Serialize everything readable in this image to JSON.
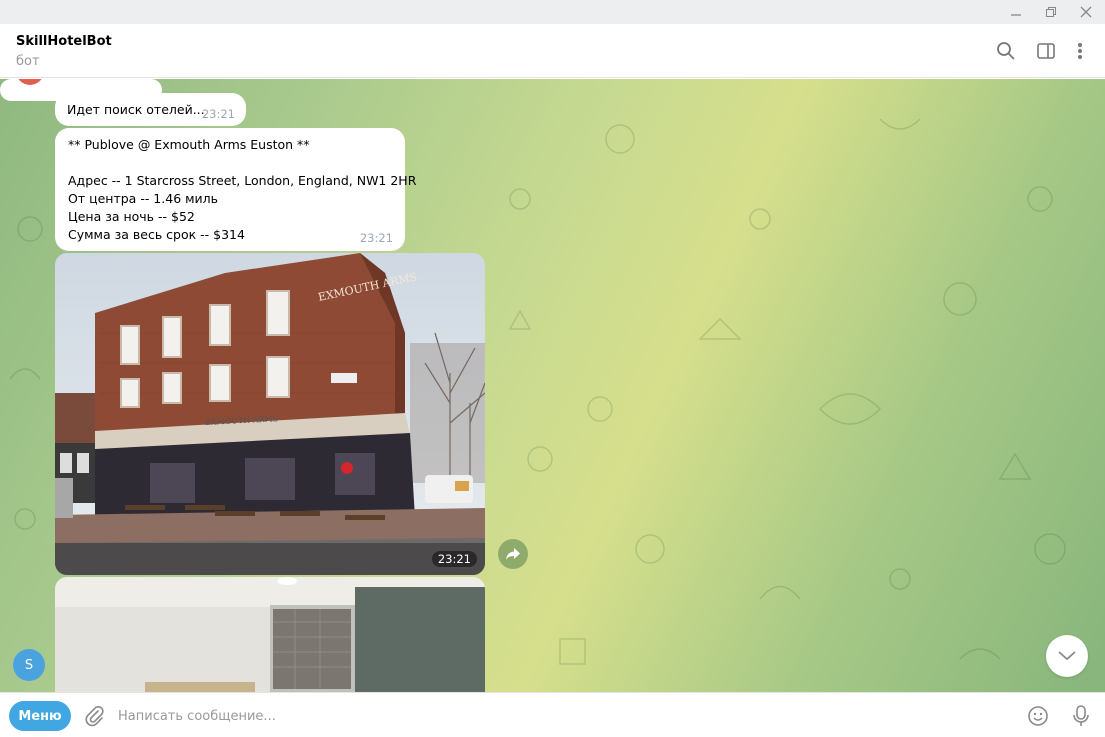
{
  "window": {
    "minimize_icon": "minimize-icon",
    "restore_icon": "restore-icon",
    "close_icon": "close-icon"
  },
  "header": {
    "title": "SkillHotelBot",
    "subtitle": "бот",
    "icons": [
      "search-icon",
      "side-panel-icon",
      "more-vertical-icon"
    ]
  },
  "messages": {
    "searching": {
      "text": "Идет поиск отелей...",
      "time": "23:21"
    },
    "hotel": {
      "name_line": "** Publove @ Exmouth Arms Euston **",
      "address": "Адрес -- 1 Starcross Street, London, England, NW1 2HR",
      "distance": "От центра -- 1.46 миль",
      "price_night": "Цена за ночь -- $52",
      "price_total": "Сумма за весь срок -- $314",
      "time": "23:21"
    },
    "photo1": {
      "sign_text": "EXMOUTH ARMS",
      "fascia_text": "EXMOUTH ARMS",
      "time": "23:21"
    }
  },
  "sidebar": {
    "avatar_letter": "S"
  },
  "composer": {
    "menu_label": "Меню",
    "placeholder": "Написать сообщение..."
  },
  "colors": {
    "accent": "#40a7e3",
    "bubble": "#ffffff",
    "time": "#9aa7b4"
  }
}
